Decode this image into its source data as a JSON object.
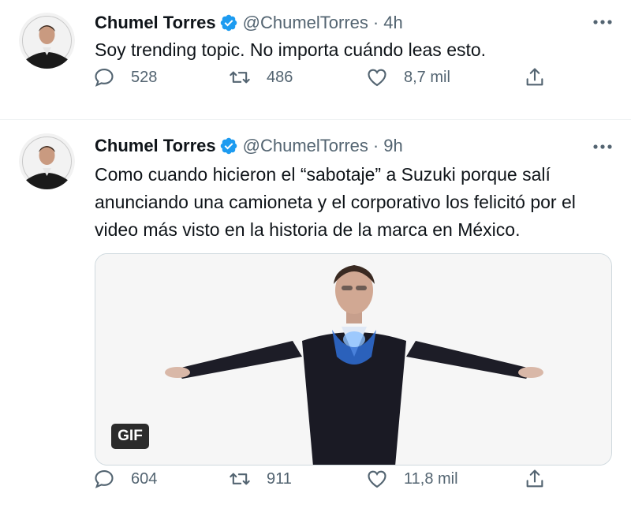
{
  "tweets": [
    {
      "display_name": "Chumel Torres",
      "handle": "@ChumelTorres",
      "separator_dot": "·",
      "time": "4h",
      "text_lines": [
        "Soy trending topic. No importa cuándo leas esto."
      ],
      "replies": "528",
      "retweets": "486",
      "likes": "8,7 mil",
      "icons": [
        "verified-badge-icon",
        "more-icon",
        "reply-icon",
        "retweet-icon",
        "like-icon",
        "share-icon"
      ]
    },
    {
      "display_name": "Chumel Torres",
      "handle": "@ChumelTorres",
      "separator_dot": "·",
      "time": "9h",
      "text_lines": [
        "Como cuando hicieron el “sabotaje” a Suzuki porque salí",
        "anunciando una camioneta y el corporativo los felicitó por el",
        "video más visto en la historia de la marca en México."
      ],
      "media_badge": "GIF",
      "replies": "604",
      "retweets": "911",
      "likes": "11,8 mil",
      "icons": [
        "verified-badge-icon",
        "more-icon",
        "reply-icon",
        "retweet-icon",
        "like-icon",
        "share-icon"
      ]
    }
  ],
  "colors": {
    "text_primary": "#0f1419",
    "text_secondary": "#536471",
    "verified_blue": "#1d9bf0",
    "divider": "#eff3f4"
  }
}
